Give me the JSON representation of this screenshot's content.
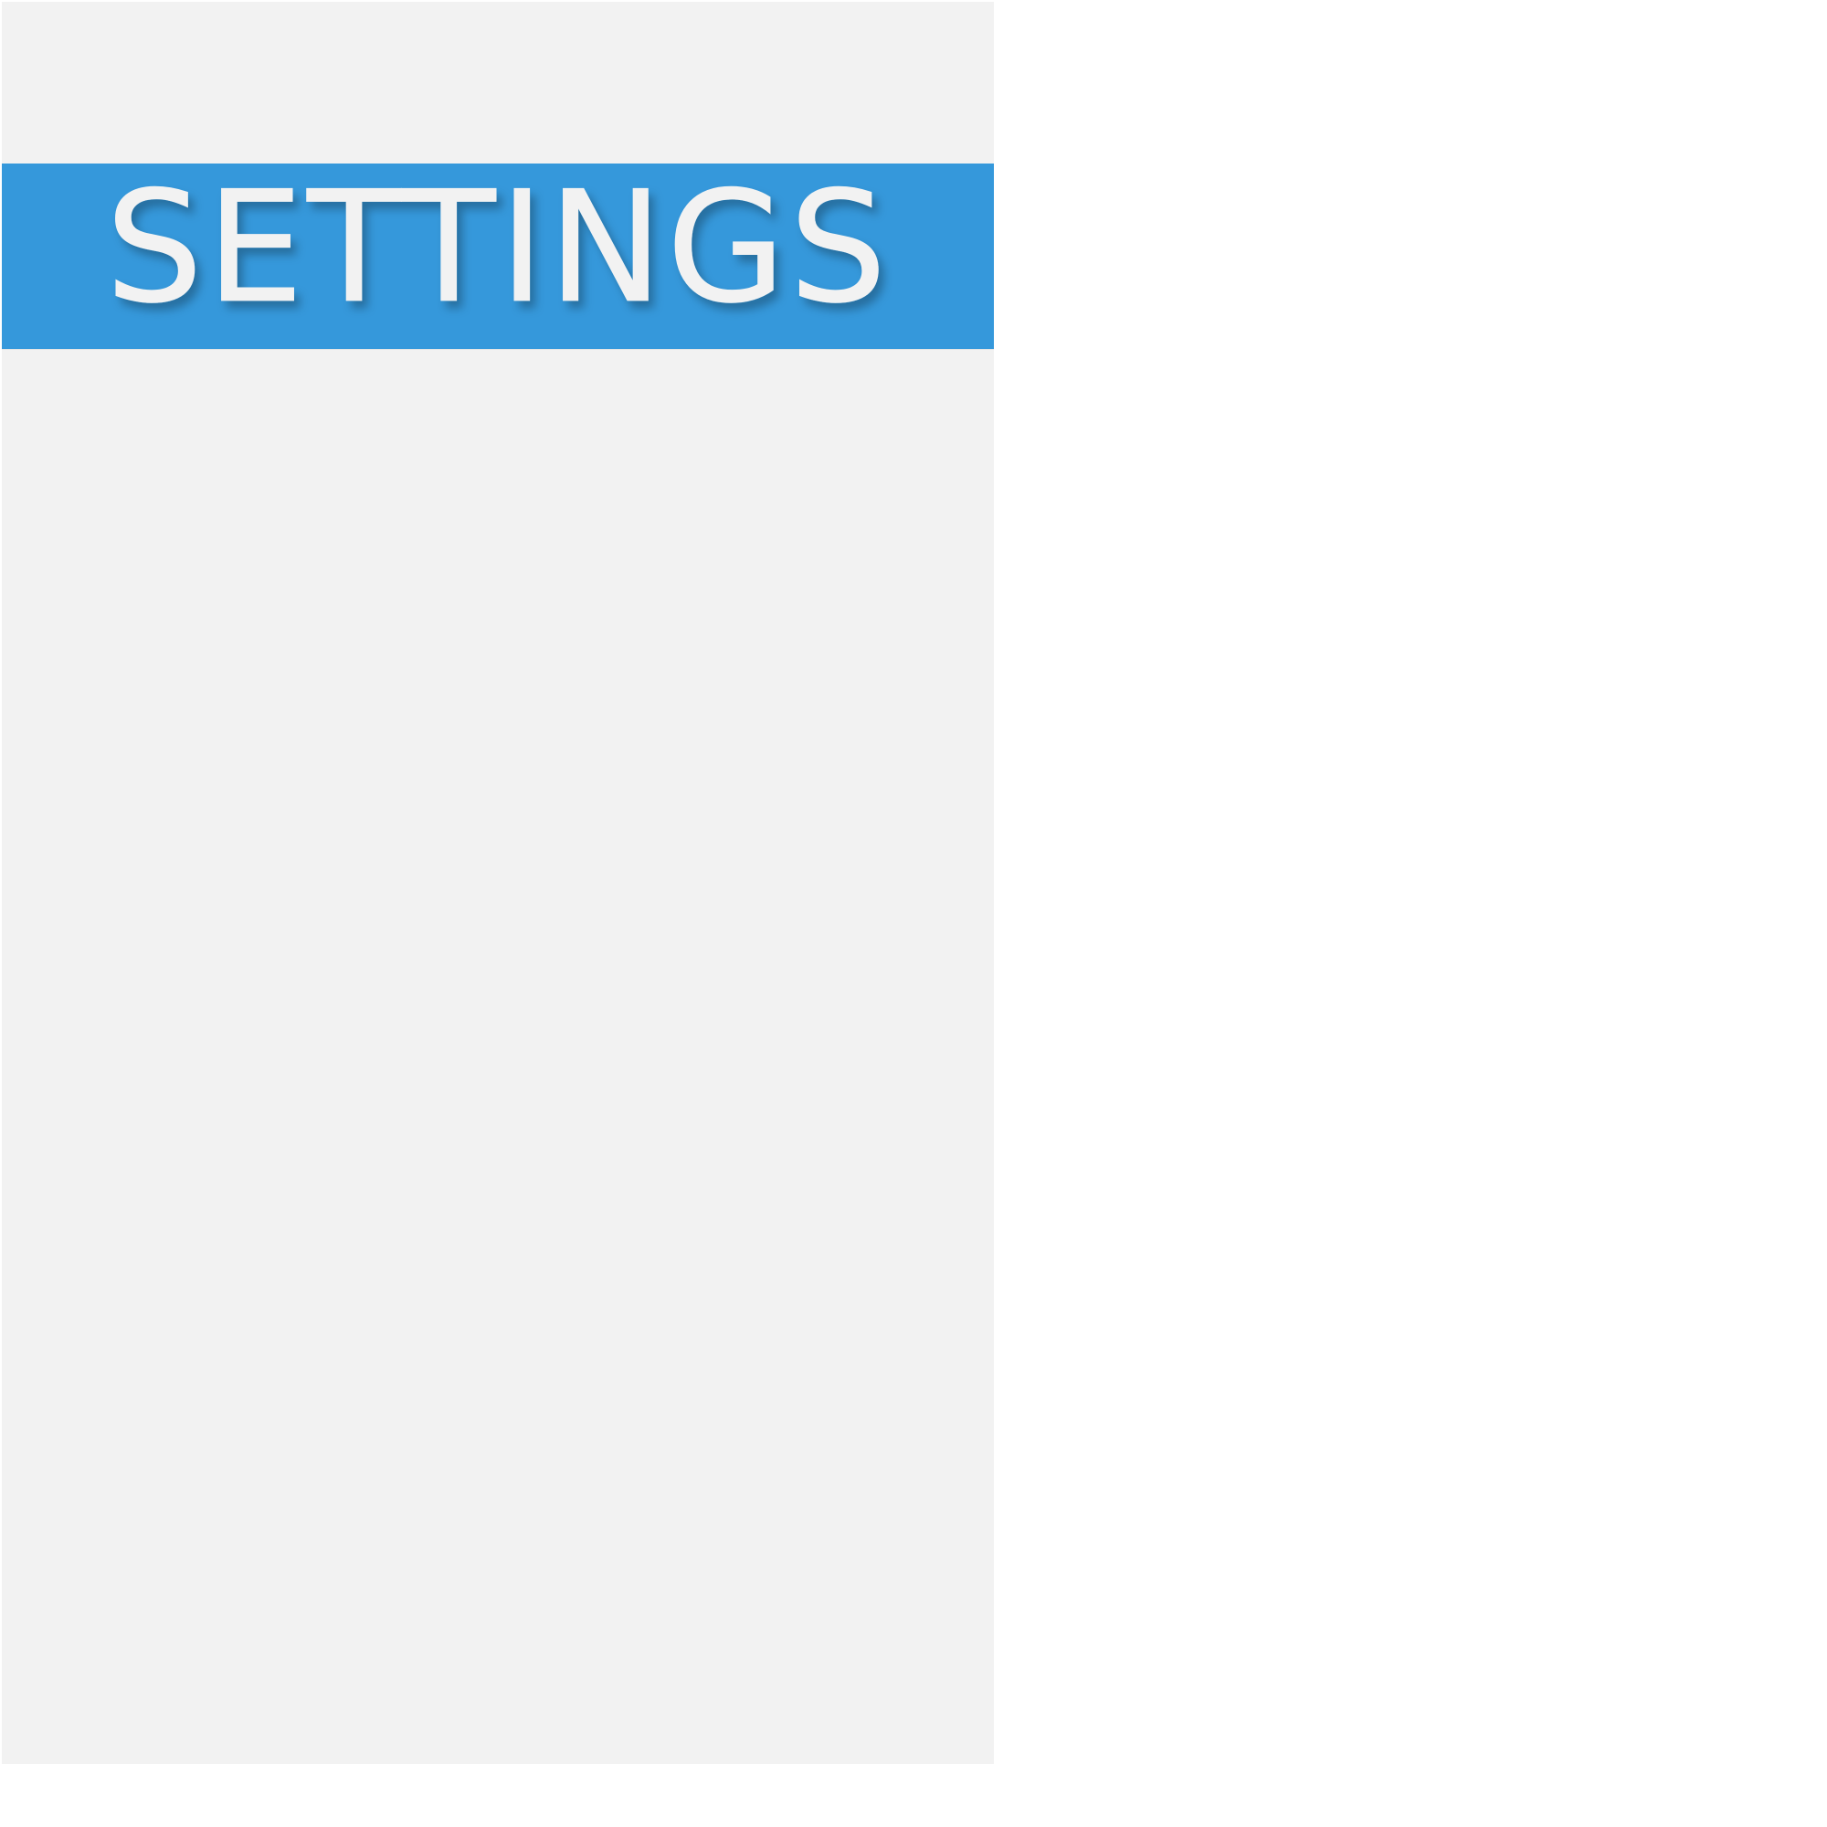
{
  "header": {
    "title": "SETTINGS"
  },
  "colors": {
    "page_background": "#ffffff",
    "panel_background": "#f2f2f2",
    "accent": "#3598db",
    "title_text": "#f2f2f2"
  }
}
